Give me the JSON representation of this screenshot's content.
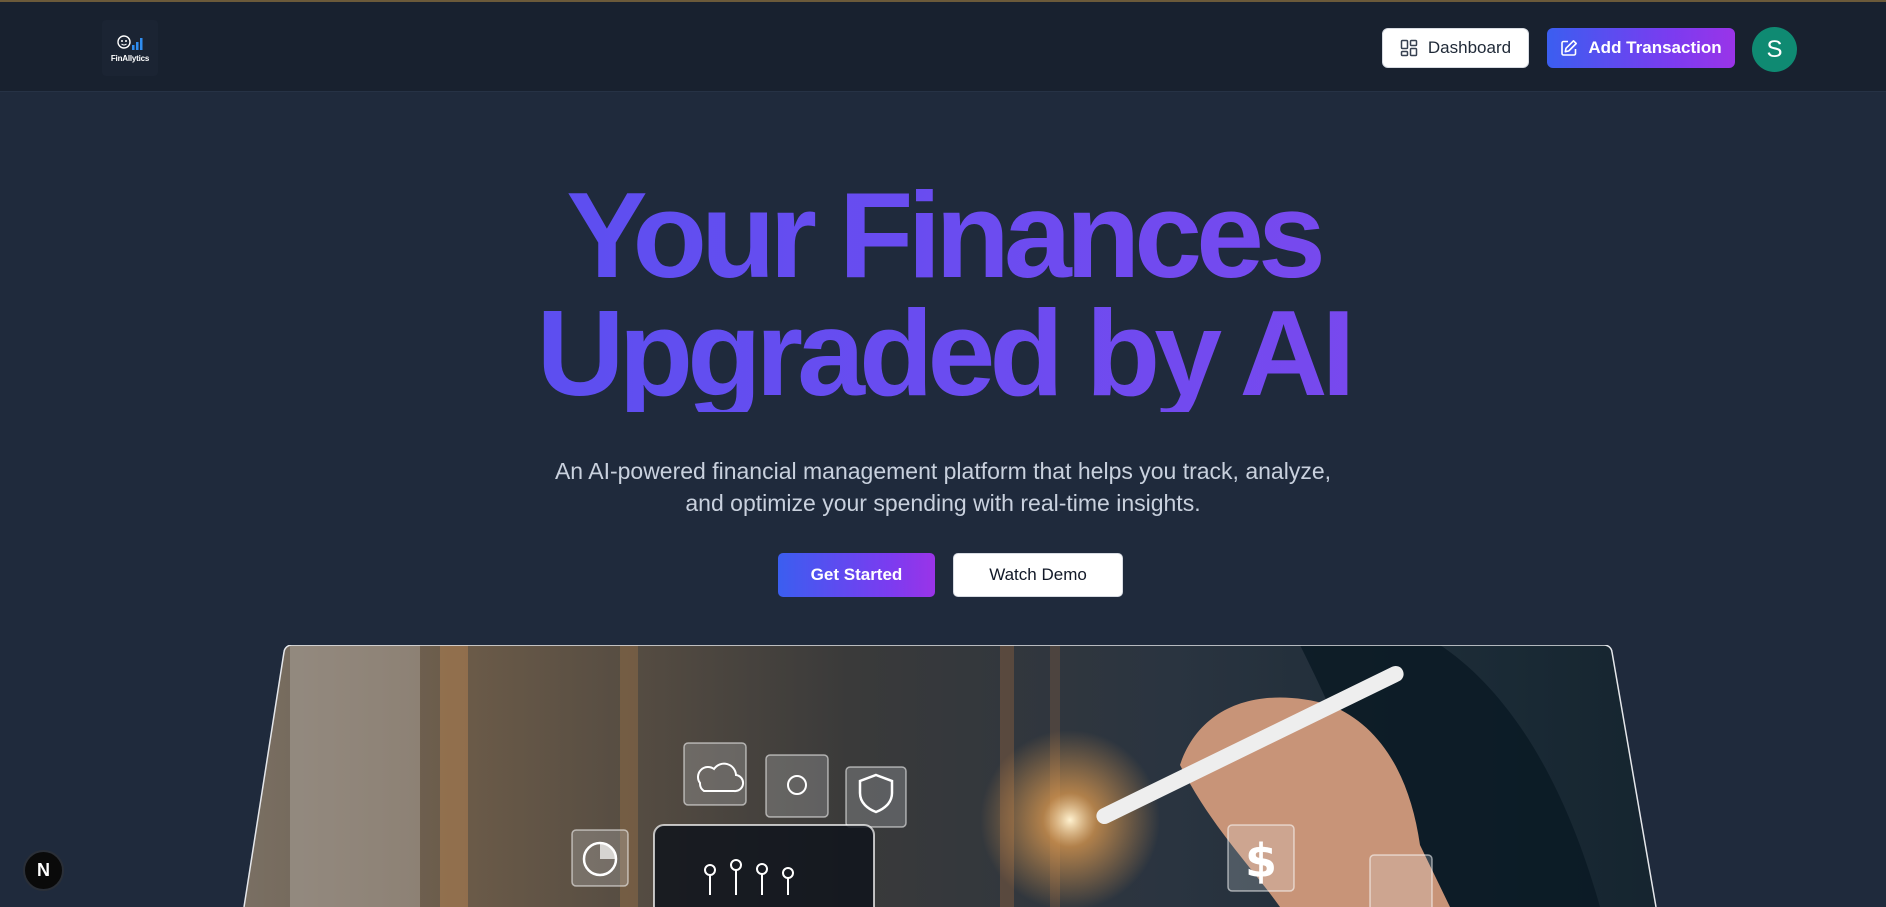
{
  "header": {
    "logo_text": "FinAllytics",
    "dashboard_label": "Dashboard",
    "add_transaction_label": "Add Transaction",
    "avatar_initial": "S"
  },
  "hero": {
    "title_line1": "Your Finances",
    "title_line2": "Upgraded by AI",
    "subtitle": "An AI-powered financial management platform that helps you track, analyze, and optimize your spending with real-time insights.",
    "get_started_label": "Get Started",
    "watch_demo_label": "Watch Demo"
  },
  "colors": {
    "page_bg": "#1f2a3c",
    "navbar_bg": "#18212f",
    "accent_blue": "#3b5ef0",
    "accent_purple": "#9a34e8",
    "avatar_bg": "#0f8a72"
  },
  "icons": {
    "dashboard": "layout-grid-icon",
    "add_transaction": "pen-square-icon",
    "dev_badge": "nextjs-icon"
  },
  "dev_badge_letter": "N"
}
